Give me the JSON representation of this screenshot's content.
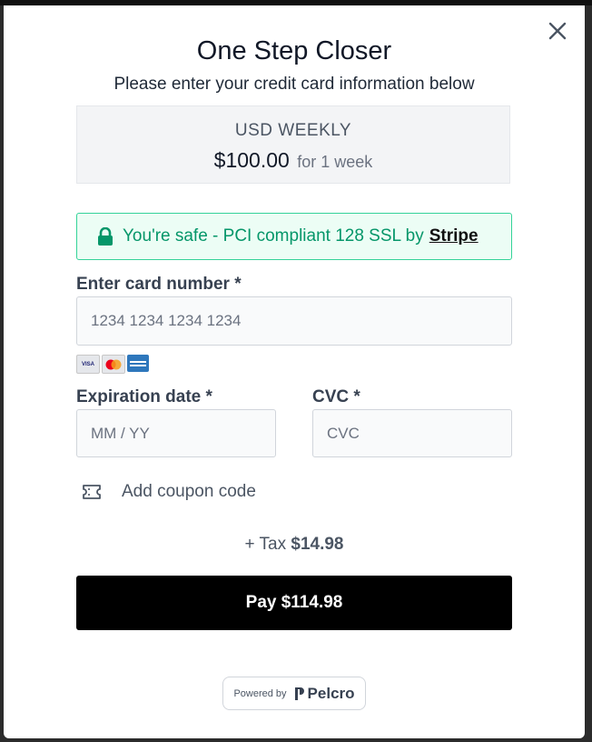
{
  "modal": {
    "title": "One Step Closer",
    "subtitle": "Please enter your credit card information below",
    "close_icon": "close-icon"
  },
  "plan": {
    "name": "USD WEEKLY",
    "price": "$100.00",
    "period": "for 1 week"
  },
  "security": {
    "icon": "lock-icon",
    "text": "You're safe - PCI compliant 128 SSL by",
    "link": "Stripe"
  },
  "card_form": {
    "card_number_label": "Enter card number *",
    "card_number_placeholder": "1234 1234 1234 1234",
    "card_brands": [
      "VISA",
      "Mastercard",
      "AMEX"
    ],
    "expiration_label": "Expiration date *",
    "expiration_placeholder": "MM / YY",
    "cvc_label": "CVC *",
    "cvc_placeholder": "CVC"
  },
  "coupon": {
    "icon": "ticket-icon",
    "label": "Add coupon code"
  },
  "tax": {
    "prefix": "+ Tax",
    "amount": "$14.98"
  },
  "pay_button": {
    "label": "Pay $114.98"
  },
  "footer": {
    "powered_by": "Powered by",
    "brand": "Pelcro"
  },
  "colors": {
    "accent_green": "#059669",
    "safe_border": "#34d399",
    "button_bg": "#000000"
  }
}
